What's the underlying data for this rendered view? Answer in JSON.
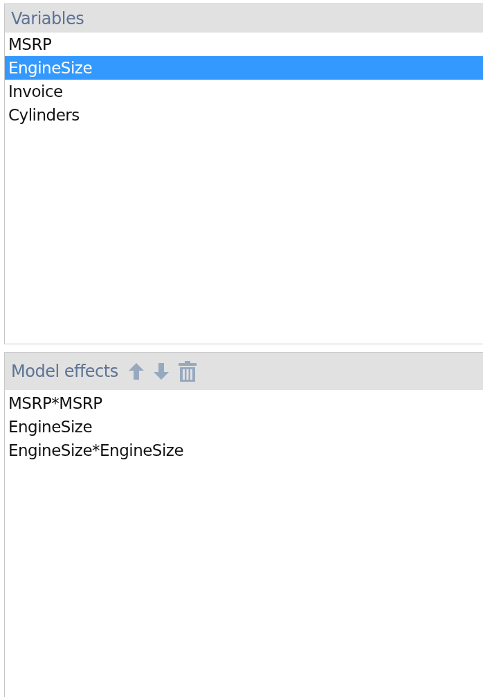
{
  "variables": {
    "title": "Variables",
    "items": [
      {
        "label": "MSRP",
        "selected": false
      },
      {
        "label": "EngineSize",
        "selected": true
      },
      {
        "label": "Invoice",
        "selected": false
      },
      {
        "label": "Cylinders",
        "selected": false
      }
    ]
  },
  "model_effects": {
    "title": "Model effects",
    "items": [
      {
        "label": "MSRP*MSRP",
        "selected": false
      },
      {
        "label": "EngineSize",
        "selected": false
      },
      {
        "label": "EngineSize*EngineSize",
        "selected": false
      }
    ]
  }
}
